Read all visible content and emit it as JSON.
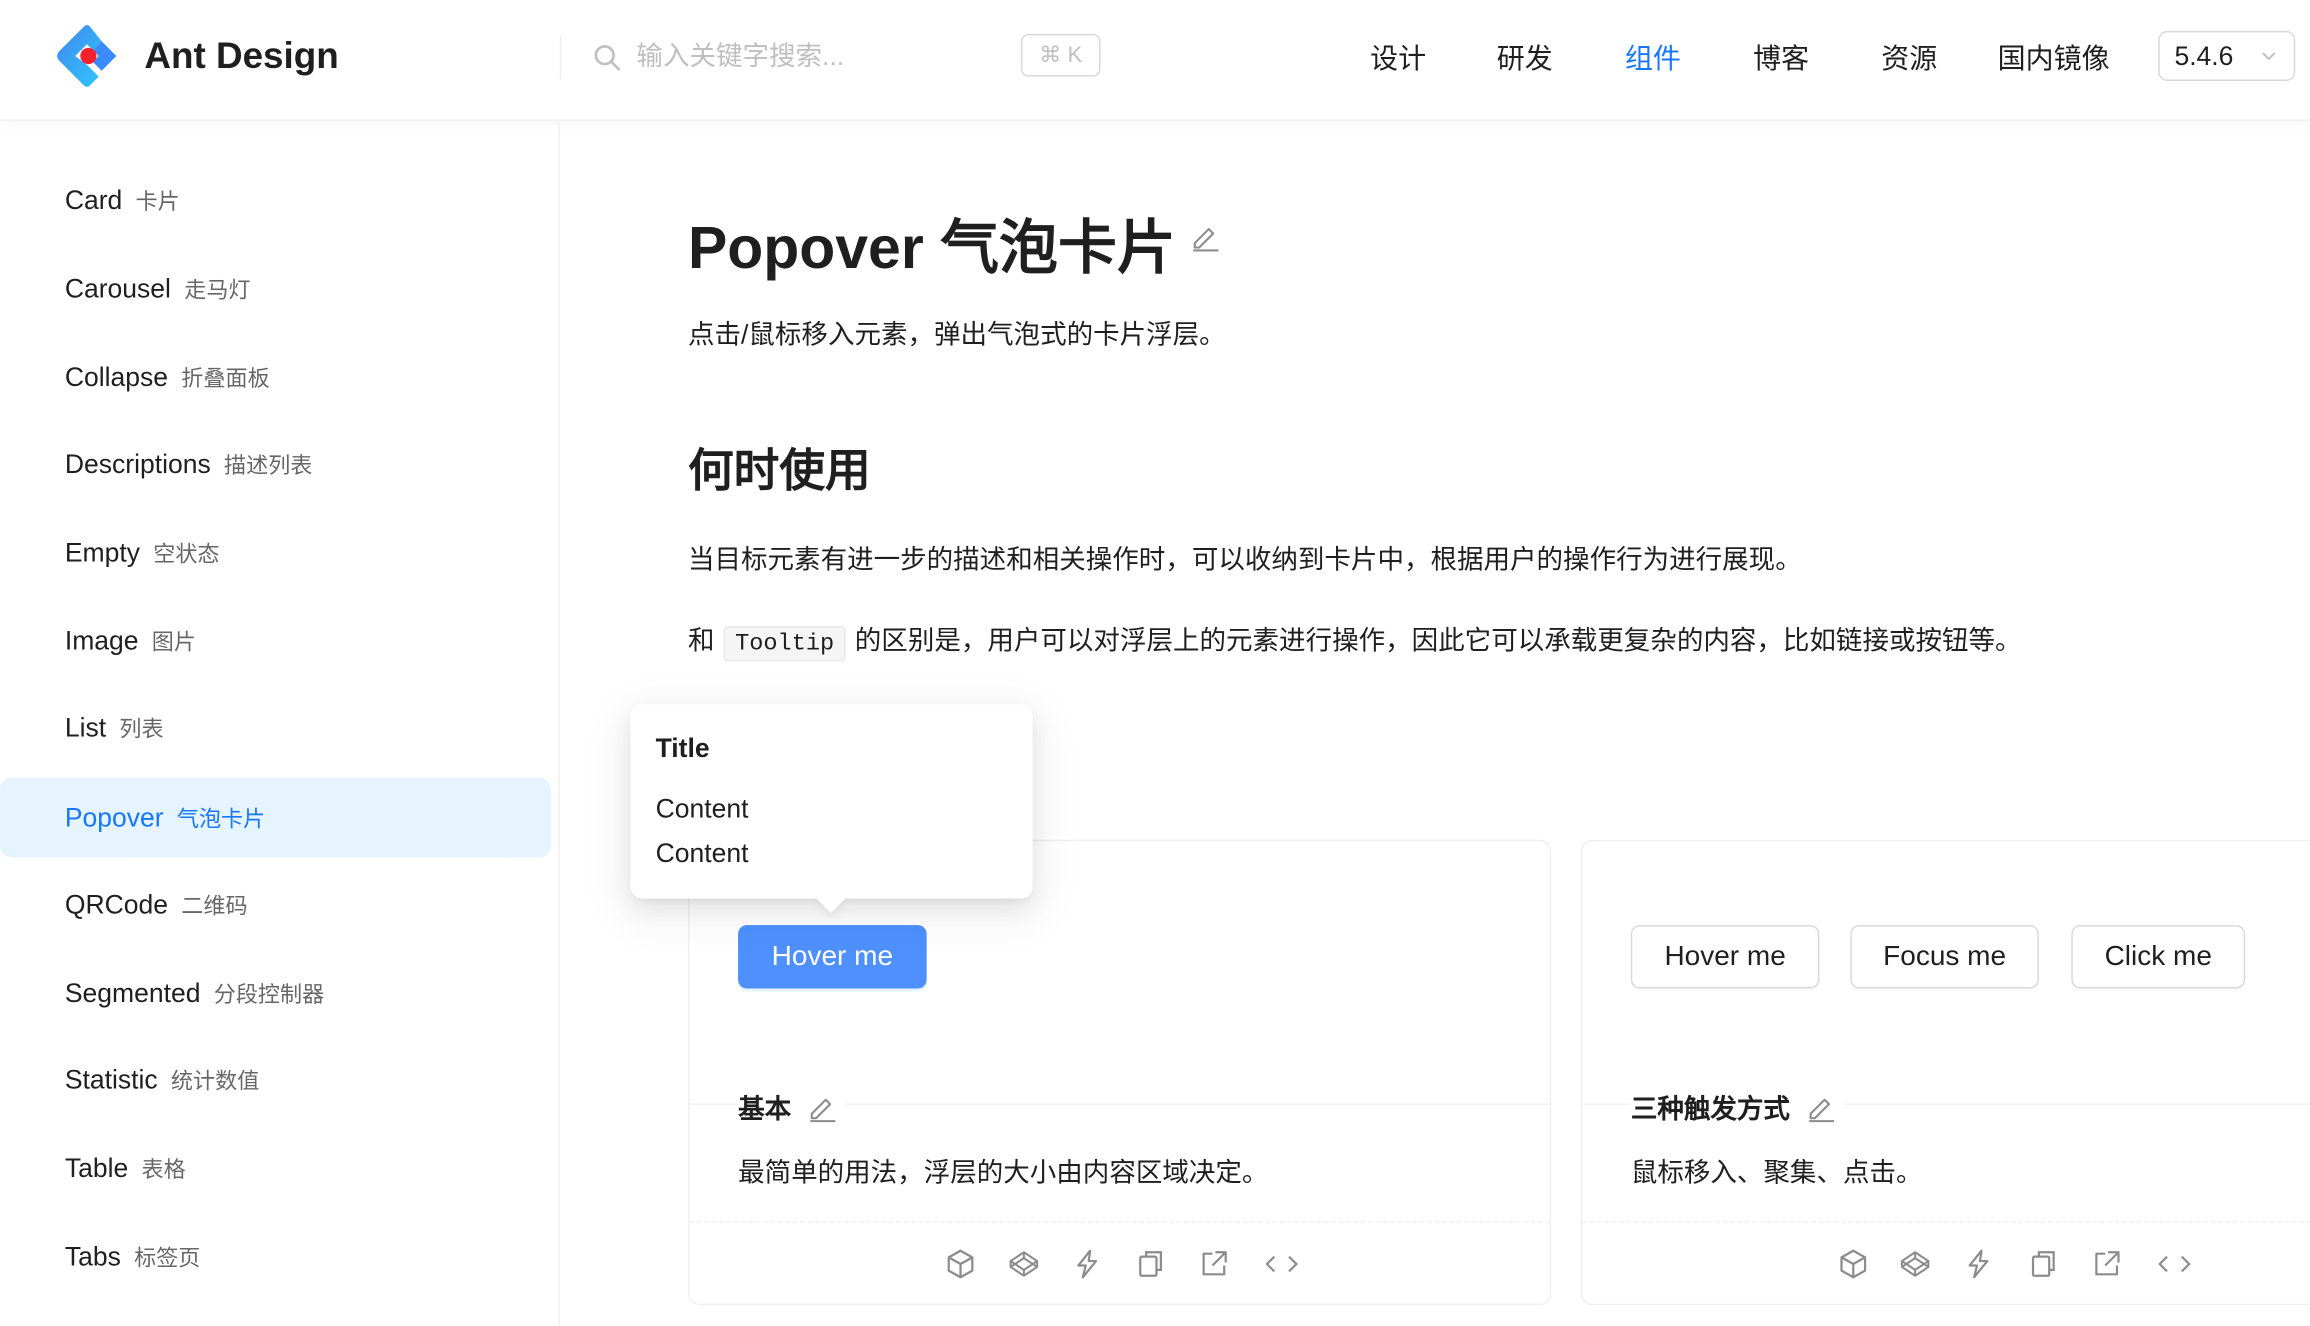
{
  "header": {
    "brand": "Ant Design",
    "search_placeholder": "输入关键字搜索...",
    "shortcut": "⌘ K",
    "nav": [
      "设计",
      "研发",
      "组件",
      "博客",
      "资源",
      "国内镜像"
    ],
    "active_nav": "组件",
    "version": "5.4.6",
    "accent_color": "#1677ff"
  },
  "sidebar": {
    "items": [
      {
        "en": "Card",
        "cn": "卡片"
      },
      {
        "en": "Carousel",
        "cn": "走马灯"
      },
      {
        "en": "Collapse",
        "cn": "折叠面板"
      },
      {
        "en": "Descriptions",
        "cn": "描述列表"
      },
      {
        "en": "Empty",
        "cn": "空状态"
      },
      {
        "en": "Image",
        "cn": "图片"
      },
      {
        "en": "List",
        "cn": "列表"
      },
      {
        "en": "Popover",
        "cn": "气泡卡片"
      },
      {
        "en": "QRCode",
        "cn": "二维码"
      },
      {
        "en": "Segmented",
        "cn": "分段控制器"
      },
      {
        "en": "Statistic",
        "cn": "统计数值"
      },
      {
        "en": "Table",
        "cn": "表格"
      },
      {
        "en": "Tabs",
        "cn": "标签页"
      }
    ],
    "active": "Popover"
  },
  "main": {
    "title": "Popover 气泡卡片",
    "subtitle": "点击/鼠标移入元素，弹出气泡式的卡片浮层。",
    "when_heading": "何时使用",
    "when_p1": "当目标元素有进一步的描述和相关操作时，可以收纳到卡片中，根据用户的操作行为进行展现。",
    "when_p2_before": "和",
    "when_p2_code": "Tooltip",
    "when_p2_after": "的区别是，用户可以对浮层上的元素进行操作，因此它可以承载更复杂的内容，比如链接或按钮等。"
  },
  "popover": {
    "title": "Title",
    "line1": "Content",
    "line2": "Content"
  },
  "demos": [
    {
      "buttons": [
        "Hover me"
      ],
      "title": "基本",
      "desc": "最简单的用法，浮层的大小由内容区域决定。"
    },
    {
      "buttons": [
        "Hover me",
        "Focus me",
        "Click me"
      ],
      "title": "三种触发方式",
      "desc": "鼠标移入、聚集、点击。"
    }
  ],
  "demo_actions": [
    "codesandbox-icon",
    "codepen-icon",
    "stackblitz-icon",
    "copy-icon",
    "open-new-window-icon",
    "expand-code-icon"
  ]
}
